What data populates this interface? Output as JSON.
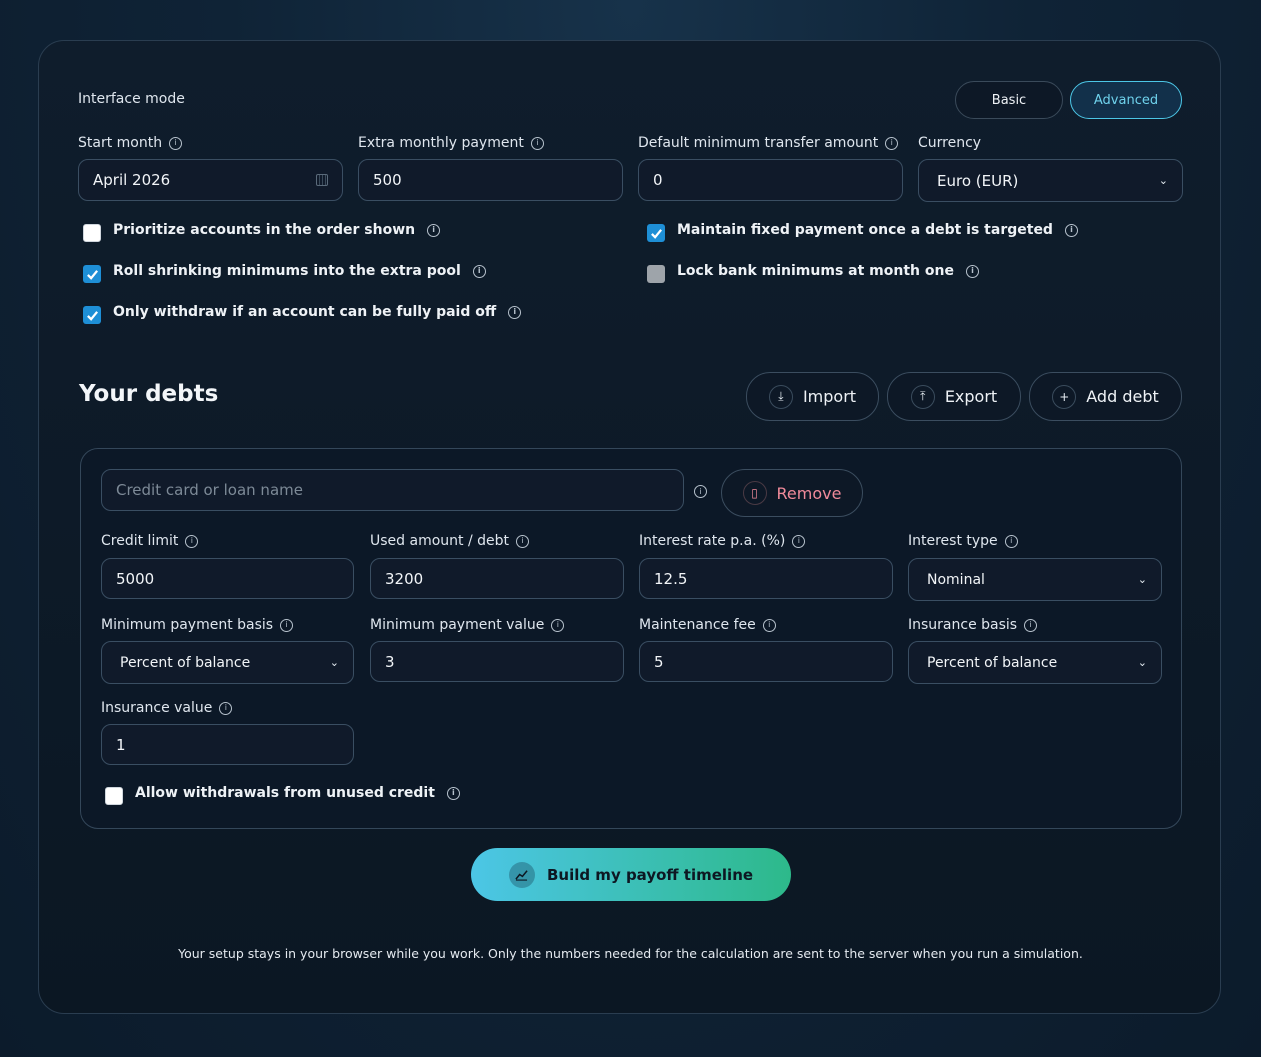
{
  "settings": {
    "interface_mode_label": "Interface mode",
    "mode_basic": "Basic",
    "mode_advanced": "Advanced",
    "mode_selected": "Advanced",
    "start_month_label": "Start month",
    "start_month_value": "April 2026",
    "extra_payment_label": "Extra monthly payment",
    "extra_payment_value": "500",
    "min_transfer_label": "Default minimum transfer amount",
    "min_transfer_value": "0",
    "currency_label": "Currency",
    "currency_value": "Euro (EUR)"
  },
  "options": [
    {
      "label": "Prioritize accounts in the order shown",
      "checked": false
    },
    {
      "label": "Roll shrinking minimums into the extra pool",
      "checked": true
    },
    {
      "label": "Only withdraw if an account can be fully paid off",
      "checked": true
    },
    {
      "label": "Maintain fixed payment once a debt is targeted",
      "checked": true
    },
    {
      "label": "Lock bank minimums at month one",
      "checked": false,
      "disabled": true
    }
  ],
  "debts": {
    "title": "Your debts",
    "import_label": "Import",
    "export_label": "Export",
    "add_label": "Add debt"
  },
  "debt_card": {
    "name_placeholder": "Credit card or loan name",
    "remove_label": "Remove",
    "credit_limit_label": "Credit limit",
    "credit_limit_value": "5000",
    "used_amount_label": "Used amount / debt",
    "used_amount_value": "3200",
    "interest_rate_label": "Interest rate p.a. (%)",
    "interest_rate_value": "12.5",
    "interest_type_label": "Interest type",
    "interest_type_value": "Nominal",
    "min_basis_label": "Minimum payment basis",
    "min_basis_value": "Percent of balance",
    "min_value_label": "Minimum payment value",
    "min_value_value": "3",
    "maintenance_fee_label": "Maintenance fee",
    "maintenance_fee_value": "5",
    "insurance_basis_label": "Insurance basis",
    "insurance_basis_value": "Percent of balance",
    "insurance_value_label": "Insurance value",
    "insurance_value_value": "1",
    "allow_withdrawals_label": "Allow withdrawals from unused credit",
    "allow_withdrawals_checked": false
  },
  "cta_label": "Build my payoff timeline",
  "footer_note": "Your setup stays in your browser while you work. Only the numbers needed for the calculation are sent to the server when you run a simulation.",
  "colors": {
    "accent": "#4cc6e6",
    "cta_end": "#2db98a",
    "remove": "#f08a9a",
    "checkbox": "#1e8fd6"
  }
}
